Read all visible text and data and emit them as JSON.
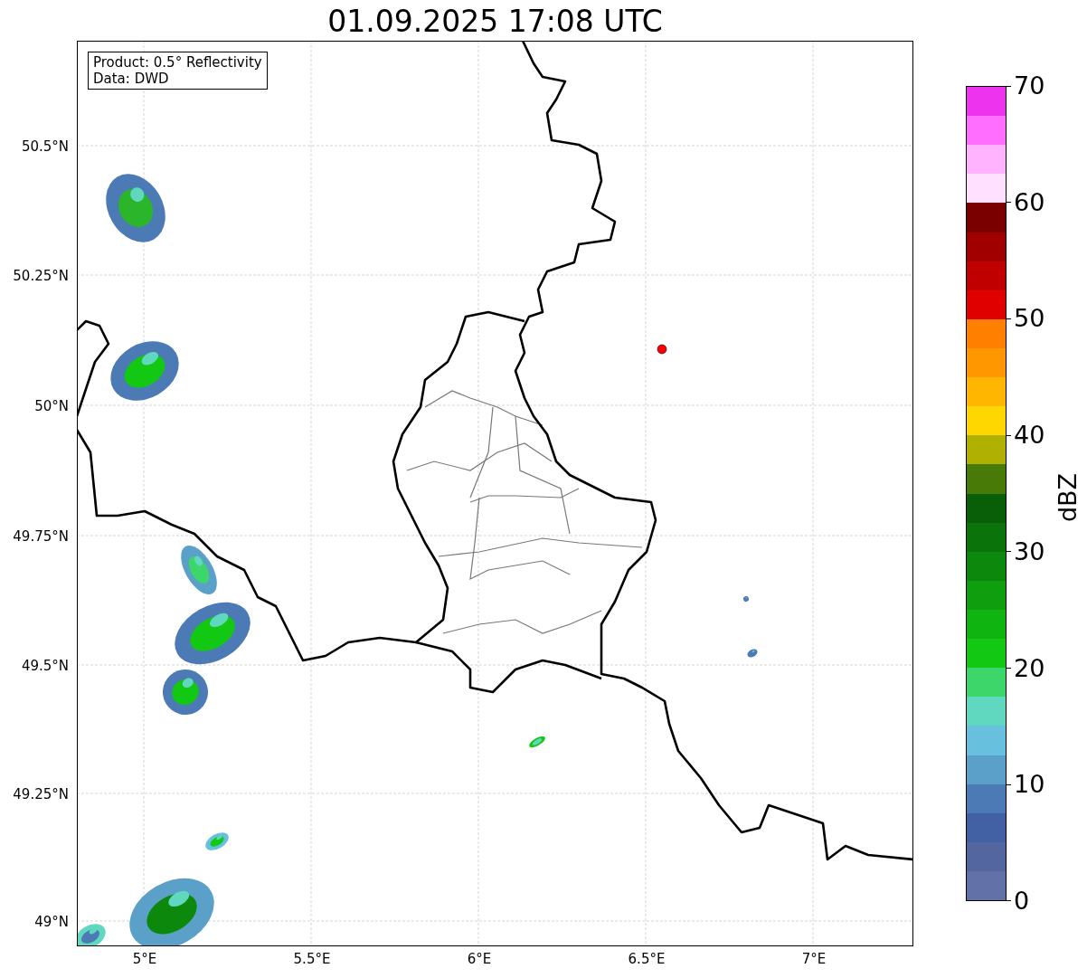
{
  "title": "01.09.2025 17:08 UTC",
  "info_box": [
    "Product: 0.5° Reflectivity",
    "Data: DWD"
  ],
  "lat_labels": [
    "50.5°N",
    "50.25°N",
    "50°N",
    "49.75°N",
    "49.5°N",
    "49.25°N",
    "49°N"
  ],
  "lon_labels": [
    "5°E",
    "5.5°E",
    "6°E",
    "6.5°E",
    "7°E"
  ],
  "colorbar": {
    "label": "dBZ",
    "ticks": [
      "70",
      "60",
      "50",
      "40",
      "30",
      "20",
      "10",
      "0"
    ],
    "bands": [
      {
        "color": "#ee33ee"
      },
      {
        "color": "#ff6eff"
      },
      {
        "color": "#ffb3ff"
      },
      {
        "color": "#ffe0ff"
      },
      {
        "color": "#7a0000"
      },
      {
        "color": "#a00000"
      },
      {
        "color": "#c00000"
      },
      {
        "color": "#e00000"
      },
      {
        "color": "#ff7f00"
      },
      {
        "color": "#ff9800"
      },
      {
        "color": "#ffb600"
      },
      {
        "color": "#ffd700"
      },
      {
        "color": "#b0b000"
      },
      {
        "color": "#487a08"
      },
      {
        "color": "#085f08"
      },
      {
        "color": "#0a730a"
      },
      {
        "color": "#0c880c"
      },
      {
        "color": "#0e9e0e"
      },
      {
        "color": "#10b410"
      },
      {
        "color": "#12c812"
      },
      {
        "color": "#3dd66a"
      },
      {
        "color": "#60d8c0"
      },
      {
        "color": "#66c0de"
      },
      {
        "color": "#5aa0c8"
      },
      {
        "color": "#4c7ab5"
      },
      {
        "color": "#4260a4"
      },
      {
        "color": "#5366a0"
      },
      {
        "color": "#6272a8"
      }
    ]
  }
}
